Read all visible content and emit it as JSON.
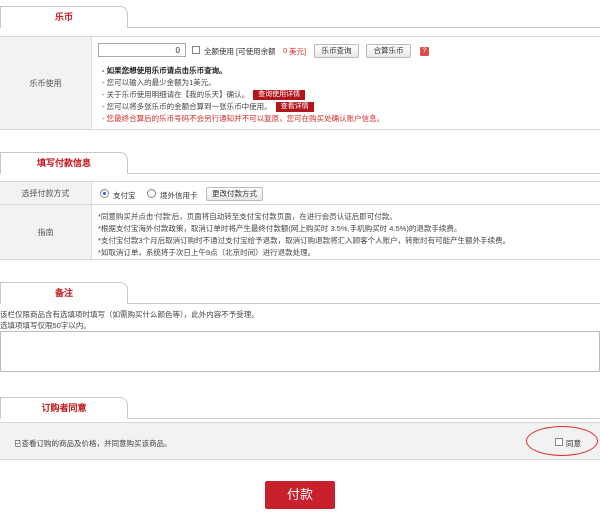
{
  "coins": {
    "tab_title": "乐币",
    "row_label": "乐币使用",
    "amount_value": "0",
    "full_use_label": "全额使用",
    "available_prefix": "[可使用余额",
    "available_value": "0",
    "available_unit": "美元]",
    "lookup_button": "乐币查询",
    "merge_button": "合算乐币",
    "help_icon": "?",
    "notes": [
      "- 如果您想使用乐币请点击乐币查询。",
      "- 您可以输入的最少金额为1美元。",
      "- 关于乐币使用明细请在【我的乐天】确认。",
      "- 您可以将多张乐币的金额合算到一张乐币中使用。",
      "- 您最终合算后的乐币号码不会另行通知并不可以复原，您可在购买处确认账户信息。"
    ],
    "usage_detail_button": "查询使用详情",
    "view_detail_button": "查看详情"
  },
  "payment": {
    "tab_title": "填写付款信息",
    "method_label": "选择付款方式",
    "option_alipay": "支付宝",
    "option_card": "境外信用卡",
    "change_button": "更改付款方式",
    "guide_label": "指南",
    "guide_lines": [
      "*同意购买并点击‘付款’后，页面将自动转至支付宝付款页面，在进行会员认证后即可付款。",
      "*根据支付宝海外付款政策，取消订单时将产生最终付款额(网上购买时 3.5%,手机购买时 4.5%)的退款手续费。",
      "*支付宝付款3个月后取消订购时不通过支付宝给予退款，取消订购退款将汇入顾客个人账户，转账时有可能产生额外手续费。",
      "*如取消订单，系统将于次日上午9点（北京时间）进行退款处理。"
    ]
  },
  "remarks": {
    "tab_title": "备注",
    "lines": [
      "该栏仅限商品含有选填项时填写（如需购买什么颜色等），此外内容不予受理。",
      "选填项填写仅限50字以内。"
    ]
  },
  "consent": {
    "tab_title": "订购者同意",
    "statement": "已查看订购的商品及价格，并同意购买该商品。",
    "agree_label": "同意"
  },
  "pay_button": "付款",
  "colors": {
    "accent": "#c4161c",
    "pay_button": "#c8202d",
    "highlight_circle": "#e03030"
  }
}
